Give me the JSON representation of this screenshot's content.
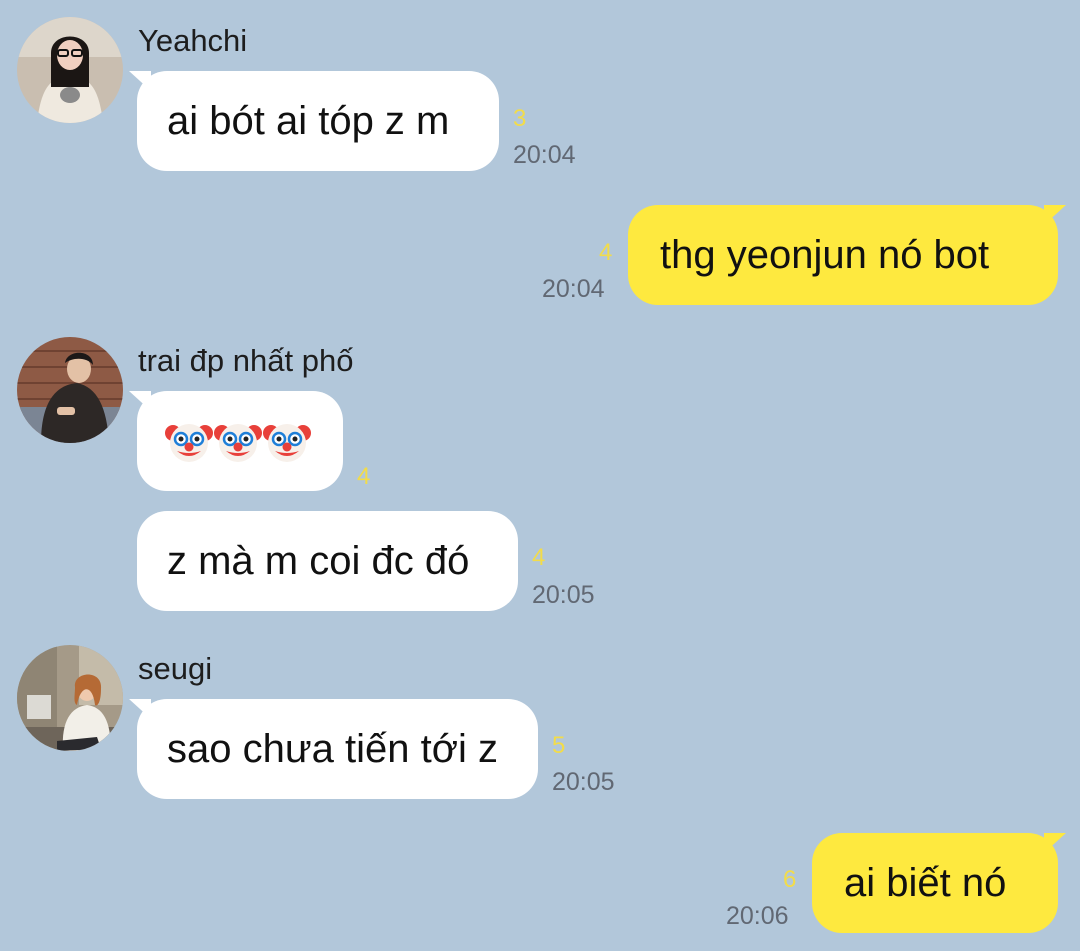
{
  "chat": {
    "groups": [
      {
        "sender": "Yeahchi",
        "messages": [
          {
            "text": "ai bót ai tóp z m",
            "unread": "3",
            "time": "20:04"
          }
        ]
      },
      {
        "outgoing": true,
        "messages": [
          {
            "text": "thg yeonjun nó bot",
            "unread": "4",
            "time": "20:04"
          }
        ]
      },
      {
        "sender": "trai đp nhất phố",
        "messages": [
          {
            "emoji": [
              "clown-face-icon",
              "clown-face-icon",
              "clown-face-icon"
            ],
            "unread": "4"
          },
          {
            "text": "z mà m coi đc đó",
            "unread": "4",
            "time": "20:05"
          }
        ]
      },
      {
        "sender": "seugi",
        "messages": [
          {
            "text": "sao chưa tiến tới z",
            "unread": "5",
            "time": "20:05"
          }
        ]
      },
      {
        "outgoing": true,
        "messages": [
          {
            "text": "ai biết nó",
            "unread": "6",
            "time": "20:06"
          }
        ]
      }
    ]
  },
  "colors": {
    "background": "#b2c7da",
    "incoming_bubble": "#ffffff",
    "outgoing_bubble": "#fee93f",
    "unread_count": "#f2dc4a",
    "timestamp": "#616873"
  }
}
